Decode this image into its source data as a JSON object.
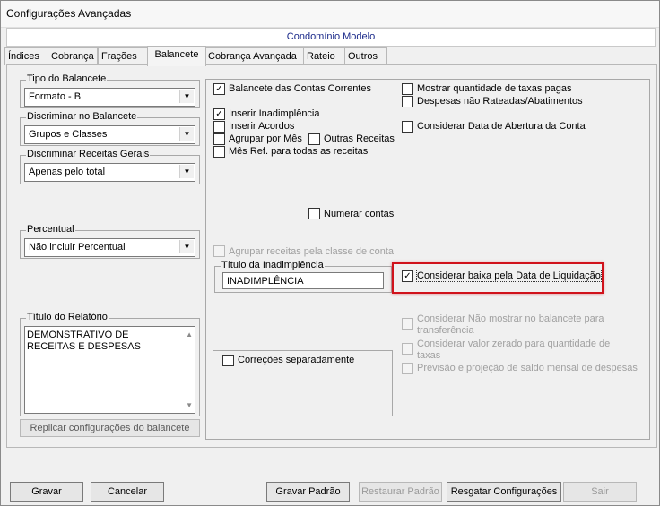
{
  "window": {
    "title": "Configurações Avançadas"
  },
  "header": {
    "text": "Condomínio Modelo"
  },
  "tabs": [
    {
      "label": "Índices"
    },
    {
      "label": "Cobrança"
    },
    {
      "label": "Frações"
    },
    {
      "label": "Balancete"
    },
    {
      "label": "Cobrança Avançada"
    },
    {
      "label": "Rateio"
    },
    {
      "label": "Outros"
    }
  ],
  "left": {
    "tipo": {
      "label": "Tipo do Balancete",
      "value": "Formato - B"
    },
    "discriminar": {
      "label": "Discriminar no Balancete",
      "value": "Grupos e Classes"
    },
    "receitas": {
      "label": "Discriminar Receitas Gerais",
      "value": "Apenas pelo total"
    },
    "percentual": {
      "label": "Percentual",
      "value": "Não incluir Percentual"
    },
    "titulo_relatorio": {
      "label": "Título do Relatório",
      "value": "DEMONSTRATIVO DE RECEITAS E DESPESAS"
    },
    "replicar": "Replicar configurações do balancete"
  },
  "checks": {
    "balancete_contas": "Balancete das Contas Correntes",
    "inserir_inad": "Inserir Inadimplência",
    "inserir_acordos": "Inserir Acordos",
    "agrupar_mes": "Agrupar por Mês",
    "outras_receitas": "Outras Receitas",
    "mes_ref": "Mês Ref. para todas as receitas",
    "mostrar_qtd": "Mostrar quantidade de taxas pagas",
    "despesas_nao_rateadas": "Despesas não Rateadas/Abatimentos",
    "considerar_abertura": "Considerar Data de Abertura da Conta",
    "numerar_contas": "Numerar contas",
    "agrupar_classe": "Agrupar receitas pela classe de conta",
    "considerar_baixa": "Considerar baixa pela Data de Liquidação",
    "nao_mostrar_1": "Considerar Não mostrar no balancete para",
    "nao_mostrar_2": "transferência",
    "valor_zerado_1": "Considerar valor zerado para quantidade de",
    "valor_zerado_2": "taxas",
    "previsao": "Previsão e projeção de saldo mensal de despesas",
    "correcoes": "Correções separadamente"
  },
  "inad": {
    "label": "Título da Inadimplência",
    "value": "INADIMPLÊNCIA"
  },
  "buttons": {
    "gravar": "Gravar",
    "cancelar": "Cancelar",
    "gravar_padrao": "Gravar Padrão",
    "restaurar_padrao": "Restaurar Padrão",
    "resgatar": "Resgatar Configurações",
    "sair": "Sair"
  },
  "colors": {
    "highlight": "#d0121b",
    "header_text": "#1b2a8a"
  }
}
